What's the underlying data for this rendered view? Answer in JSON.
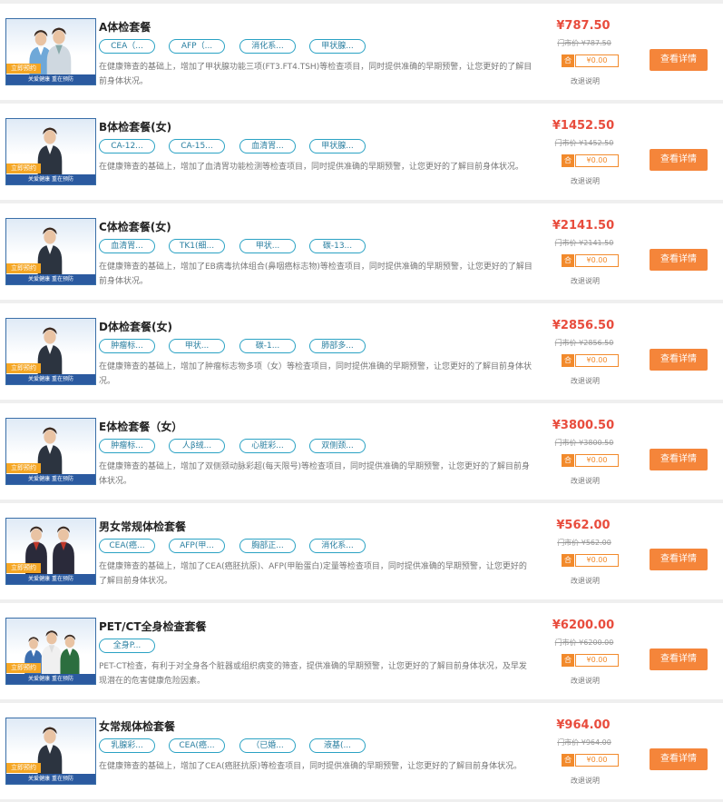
{
  "packages": [
    {
      "title": "A体检套餐",
      "tags": [
        "CEA（...",
        "AFP（...",
        "消化系...",
        "甲状腺..."
      ],
      "desc": "在健康筛查的基础上，增加了甲状腺功能三项(FT3.FT4.TSH)等检查项目，同时提供准确的早期预警，让您更好的了解目前身体状况。",
      "price": "¥787.50",
      "market_price": "门市价 ¥787.50",
      "tax_icon": "合",
      "tax_value": "¥0.00",
      "note": "改退说明",
      "button": "查看详情",
      "image": "couple-photo",
      "badge": "立即预约",
      "band": "关爱健康  重在预防"
    },
    {
      "title": "B体检套餐(女)",
      "tags": [
        "CA-12...",
        "CA-15...",
        "血清胃...",
        "甲状腺..."
      ],
      "desc": "在健康筛查的基础上，增加了血清胃功能检测等检查项目，同时提供准确的早期预警，让您更好的了解目前身体状况。",
      "price": "¥1452.50",
      "market_price": "门市价 ¥1452.50",
      "tax_icon": "合",
      "tax_value": "¥0.00",
      "note": "改退说明",
      "button": "查看详情",
      "image": "woman-photo",
      "badge": "立即预约",
      "band": "关爱健康  重在预防"
    },
    {
      "title": "C体检套餐(女)",
      "tags": [
        "血清胃...",
        "TK1(细...",
        "甲状...",
        "碳-13..."
      ],
      "desc": "在健康筛查的基础上，增加了EB病毒抗体组合(鼻咽癌标志物)等检查项目，同时提供准确的早期预警，让您更好的了解目前身体状况。",
      "price": "¥2141.50",
      "market_price": "门市价 ¥2141.50",
      "tax_icon": "合",
      "tax_value": "¥0.00",
      "note": "改退说明",
      "button": "查看详情",
      "image": "woman-photo",
      "badge": "立即预约",
      "band": "关爱健康  重在预防"
    },
    {
      "title": "D体检套餐(女)",
      "tags": [
        "肿瘤标...",
        "甲状...",
        "碳-1...",
        "肺部多..."
      ],
      "desc": "在健康筛查的基础上，增加了肿瘤标志物多项（女）等检查项目，同时提供准确的早期预警，让您更好的了解目前身体状况。",
      "price": "¥2856.50",
      "market_price": "门市价 ¥2856.50",
      "tax_icon": "合",
      "tax_value": "¥0.00",
      "note": "改退说明",
      "button": "查看详情",
      "image": "woman-photo",
      "badge": "立即预约",
      "band": "关爱健康  重在预防"
    },
    {
      "title": "E体检套餐（女）",
      "tags": [
        "肿瘤标...",
        "人β绒...",
        "心脏彩...",
        "双侧颈..."
      ],
      "desc": "在健康筛查的基础上，增加了双侧颈动脉彩超(每天限号)等检查项目，同时提供准确的早期预警，让您更好的了解目前身体状况。",
      "price": "¥3800.50",
      "market_price": "门市价 ¥3800.50",
      "tax_icon": "合",
      "tax_value": "¥0.00",
      "note": "改退说明",
      "button": "查看详情",
      "image": "woman-photo",
      "badge": "立即预约",
      "band": "关爱健康  重在预防"
    },
    {
      "title": "男女常规体检套餐",
      "tags": [
        "CEA(癌...",
        "AFP(甲...",
        "胸部正...",
        "消化系..."
      ],
      "desc": "在健康筛查的基础上，增加了CEA(癌胚抗原)、AFP(甲胎蛋白)定量等检查项目，同时提供准确的早期预警，让您更好的了解目前身体状况。",
      "price": "¥562.00",
      "market_price": "门市价 ¥562.00",
      "tax_icon": "合",
      "tax_value": "¥0.00",
      "note": "改退说明",
      "button": "查看详情",
      "image": "two-staff-photo",
      "badge": "立即预约",
      "band": "关爱健康  重在预防"
    },
    {
      "title": "PET/CT全身检查套餐",
      "tags": [
        "全身P..."
      ],
      "desc": "PET-CT检查，有利于对全身各个脏器或组织病变的筛查，提供准确的早期预警，让您更好的了解目前身体状况，及早发现潜在的危害健康危险因素。",
      "price": "¥6200.00",
      "market_price": "门市价 ¥6200.00",
      "tax_icon": "合",
      "tax_value": "¥0.00",
      "note": "改退说明",
      "button": "查看详情",
      "image": "group-photo",
      "badge": "立即预约",
      "band": "关爱健康  重在预防"
    },
    {
      "title": "女常规体检套餐",
      "tags": [
        "乳腺彩...",
        "CEA(癌...",
        "（已婚...",
        "液基(..."
      ],
      "desc": "在健康筛查的基础上，增加了CEA(癌胚抗原)等检查项目，同时提供准确的早期预警，让您更好的了解目前身体状况。",
      "price": "¥964.00",
      "market_price": "门市价 ¥964.00",
      "tax_icon": "合",
      "tax_value": "¥0.00",
      "note": "改退说明",
      "button": "查看详情",
      "image": "woman-photo",
      "badge": "立即预约",
      "band": "关爱健康  重在预防"
    }
  ],
  "colors": {
    "price": "#e84c3d",
    "button": "#f5853a",
    "tag_border": "#2aa2c4",
    "tax": "#f28a2c"
  }
}
